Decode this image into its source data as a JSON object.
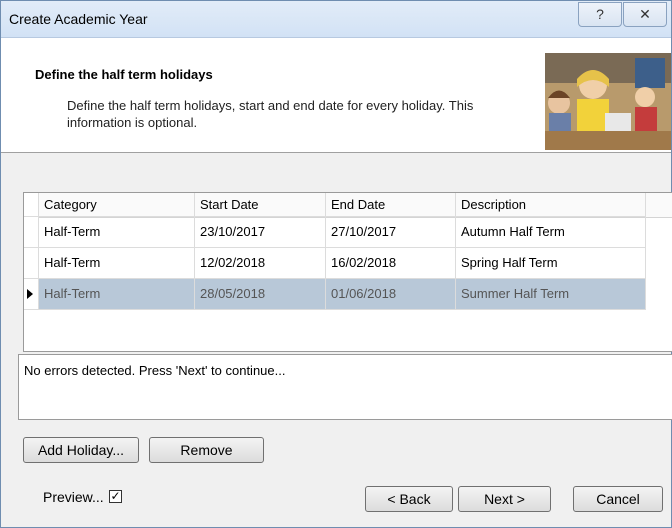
{
  "window": {
    "title": "Create Academic Year",
    "help_symbol": "?",
    "close_symbol": "✕"
  },
  "header": {
    "title": "Define the half term holidays",
    "description": "Define the half term holidays, start and end date for every holiday. This information is optional."
  },
  "grid": {
    "columns": [
      "Category",
      "Start Date",
      "End Date",
      "Description"
    ],
    "rows": [
      {
        "category": "Half-Term",
        "start": "23/10/2017",
        "end": "27/10/2017",
        "description": "Autumn Half Term"
      },
      {
        "category": "Half-Term",
        "start": "12/02/2018",
        "end": "16/02/2018",
        "description": "Spring Half Term"
      },
      {
        "category": "Half-Term",
        "start": "28/05/2018",
        "end": "01/06/2018",
        "description": "Summer Half Term"
      }
    ],
    "selected_row_index": 2
  },
  "messages": {
    "text": "No errors detected. Press 'Next' to continue..."
  },
  "buttons": {
    "add_holiday": "Add Holiday...",
    "remove": "Remove",
    "back": "< Back",
    "next": "Next >",
    "cancel": "Cancel"
  },
  "preview": {
    "label": "Preview...",
    "checked": true,
    "check_glyph": "✓"
  },
  "colors": {
    "selected_row": "#b8c8d8",
    "titlebar": "#d2e2f5"
  }
}
